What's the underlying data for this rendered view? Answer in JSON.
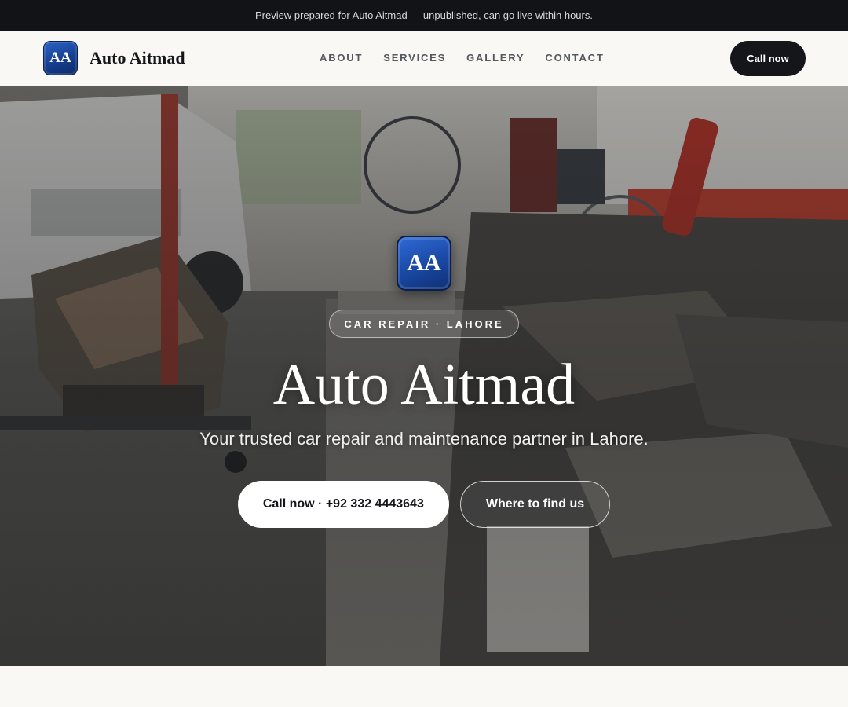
{
  "preview_banner": {
    "text": "Preview prepared for Auto Aitmad — unpublished, can go live within hours."
  },
  "header": {
    "logo_text": "AA",
    "brand_name": "Auto Aitmad",
    "nav": [
      {
        "label": "ABOUT"
      },
      {
        "label": "SERVICES"
      },
      {
        "label": "GALLERY"
      },
      {
        "label": "CONTACT"
      }
    ],
    "call_label": "Call now"
  },
  "hero": {
    "logo_text": "AA",
    "tag": "CAR REPAIR · LAHORE",
    "title": "Auto Aitmad",
    "subtitle": "Your trusted car repair and maintenance partner in Lahore.",
    "primary_button": "Call now · +92 332 4443643",
    "secondary_button": "Where to find us",
    "background_image": "workshop-photo-engines-and-parts"
  },
  "colors": {
    "brand_blue": "#1a48a3",
    "dark": "#15161a",
    "page_bg": "#f9f8f5"
  }
}
